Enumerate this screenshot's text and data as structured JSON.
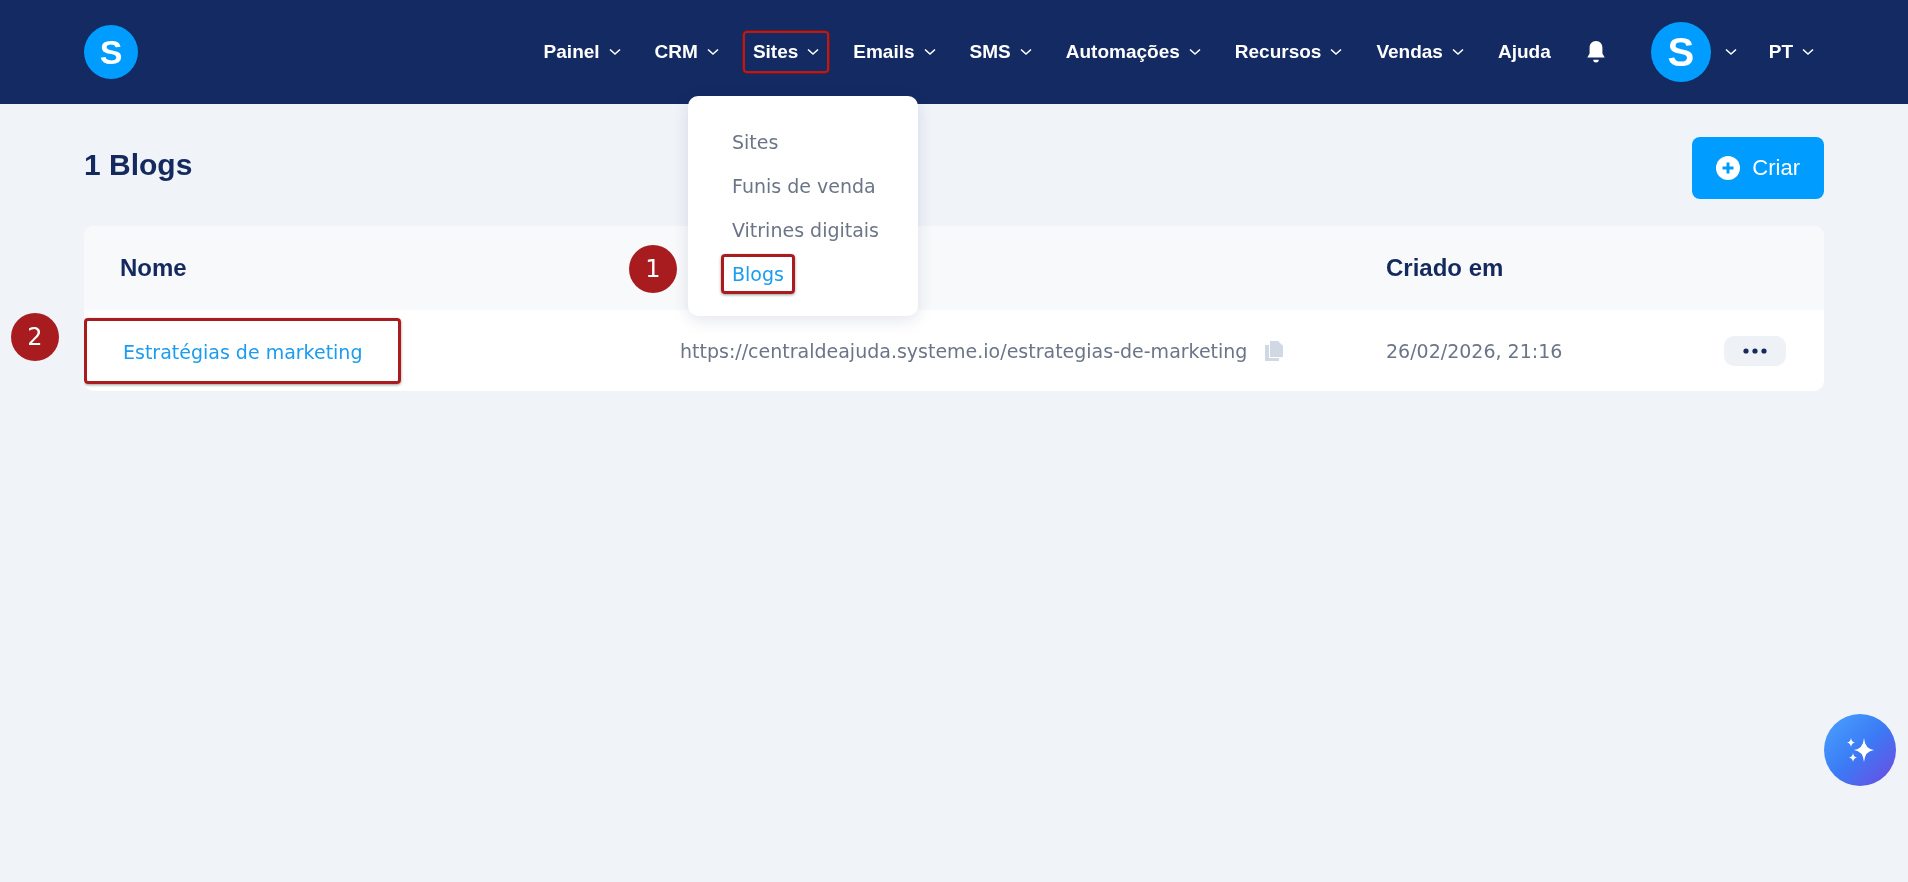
{
  "header": {
    "logo": "S",
    "nav": [
      {
        "label": "Painel",
        "caret": true,
        "highlighted": false
      },
      {
        "label": "CRM",
        "caret": true,
        "highlighted": false
      },
      {
        "label": "Sites",
        "caret": true,
        "highlighted": true
      },
      {
        "label": "Emails",
        "caret": true,
        "highlighted": false
      },
      {
        "label": "SMS",
        "caret": true,
        "highlighted": false
      },
      {
        "label": "Automações",
        "caret": true,
        "highlighted": false
      },
      {
        "label": "Recursos",
        "caret": true,
        "highlighted": false
      },
      {
        "label": "Vendas",
        "caret": true,
        "highlighted": false
      },
      {
        "label": "Ajuda",
        "caret": false,
        "highlighted": false
      }
    ],
    "avatar": "S",
    "language": "PT"
  },
  "dropdown": {
    "items": [
      {
        "label": "Sites",
        "selected": false,
        "highlighted": false
      },
      {
        "label": "Funis de venda",
        "selected": false,
        "highlighted": false
      },
      {
        "label": "Vitrines digitais",
        "selected": false,
        "highlighted": false
      },
      {
        "label": "Blogs",
        "selected": true,
        "highlighted": true
      }
    ]
  },
  "page": {
    "title": "1 Blogs",
    "create_button": "Criar"
  },
  "table": {
    "columns": [
      "Nome",
      "Criado em"
    ],
    "rows": [
      {
        "name": "Estratégias de marketing",
        "url": "https://centraldeajuda.systeme.io/estrategias-de-marketing",
        "created": "26/02/2026, 21:16",
        "highlighted": true
      }
    ]
  },
  "callouts": [
    {
      "number": "1"
    },
    {
      "number": "2"
    }
  ]
}
